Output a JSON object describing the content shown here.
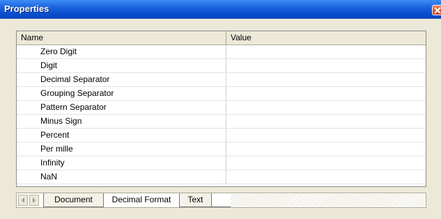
{
  "window": {
    "title": "Properties"
  },
  "table": {
    "headers": [
      "Name",
      "Value"
    ],
    "rows": [
      {
        "name": "Zero Digit",
        "value": ""
      },
      {
        "name": "Digit",
        "value": ""
      },
      {
        "name": "Decimal Separator",
        "value": ""
      },
      {
        "name": "Grouping Separator",
        "value": ""
      },
      {
        "name": "Pattern Separator",
        "value": ""
      },
      {
        "name": "Minus Sign",
        "value": ""
      },
      {
        "name": "Percent",
        "value": ""
      },
      {
        "name": "Per mille",
        "value": ""
      },
      {
        "name": "Infinity",
        "value": ""
      },
      {
        "name": "NaN",
        "value": ""
      }
    ]
  },
  "tabs": [
    {
      "label": "Document",
      "active": false
    },
    {
      "label": "Decimal Format",
      "active": true
    },
    {
      "label": "Text",
      "active": false
    }
  ],
  "icons": {
    "close": "close-icon",
    "prev": "arrow-left-icon",
    "next": "arrow-right-icon"
  },
  "colors": {
    "titlebar": "#0a4fd0",
    "window_bg": "#ece9d8",
    "close_button": "#c43c16"
  }
}
